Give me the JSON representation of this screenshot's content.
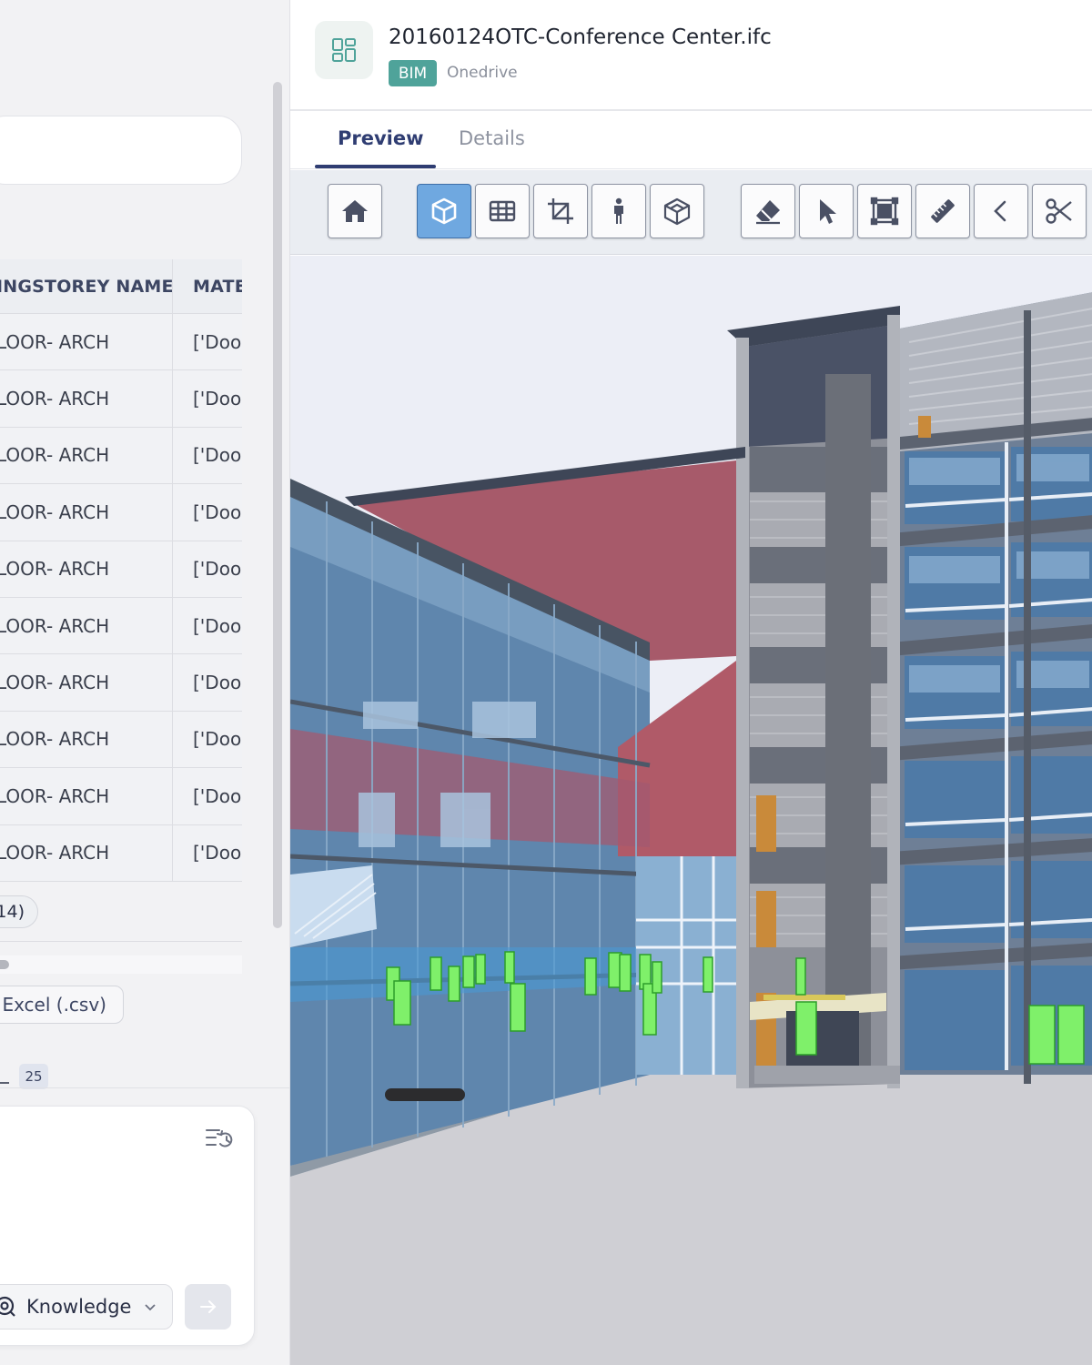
{
  "left": {
    "table": {
      "headers": [
        "INGSTOREY NAME",
        "MATEI"
      ],
      "rows": [
        [
          "LOOR- ARCH",
          "['Door"
        ],
        [
          "LOOR- ARCH",
          "['Door"
        ],
        [
          "LOOR- ARCH",
          "['Door"
        ],
        [
          "LOOR- ARCH",
          "['Door"
        ],
        [
          "LOOR- ARCH",
          "['Door"
        ],
        [
          "LOOR- ARCH",
          "['Door"
        ],
        [
          "LOOR- ARCH",
          "['Door"
        ],
        [
          "LOOR- ARCH",
          "['Door"
        ],
        [
          "LOOR- ARCH",
          "['Door"
        ],
        [
          "LOOR- ARCH",
          "['Door"
        ]
      ]
    },
    "count_pill": "14)",
    "export_label": "Excel (.csv)",
    "page_size": "25",
    "knowledge_label": "Knowledge"
  },
  "right": {
    "file_title": "20160124OTC-Conference Center.ifc",
    "badge": "BIM",
    "source": "Onedrive",
    "tabs": {
      "preview": "Preview",
      "details": "Details"
    },
    "toolbar_icons": [
      "home-icon",
      "cube-3d-icon",
      "grid-icon",
      "crop-icon",
      "person-walk-icon",
      "box-section-icon",
      "eraser-icon",
      "pointer-icon",
      "fit-frame-icon",
      "ruler-icon",
      "chevron-left-icon",
      "scissors-icon"
    ],
    "active_tool": "cube-3d-icon",
    "colors": {
      "accent": "#2f3d72",
      "bim_badge": "#4fa39a",
      "active_tool": "#6fa8e0"
    }
  }
}
